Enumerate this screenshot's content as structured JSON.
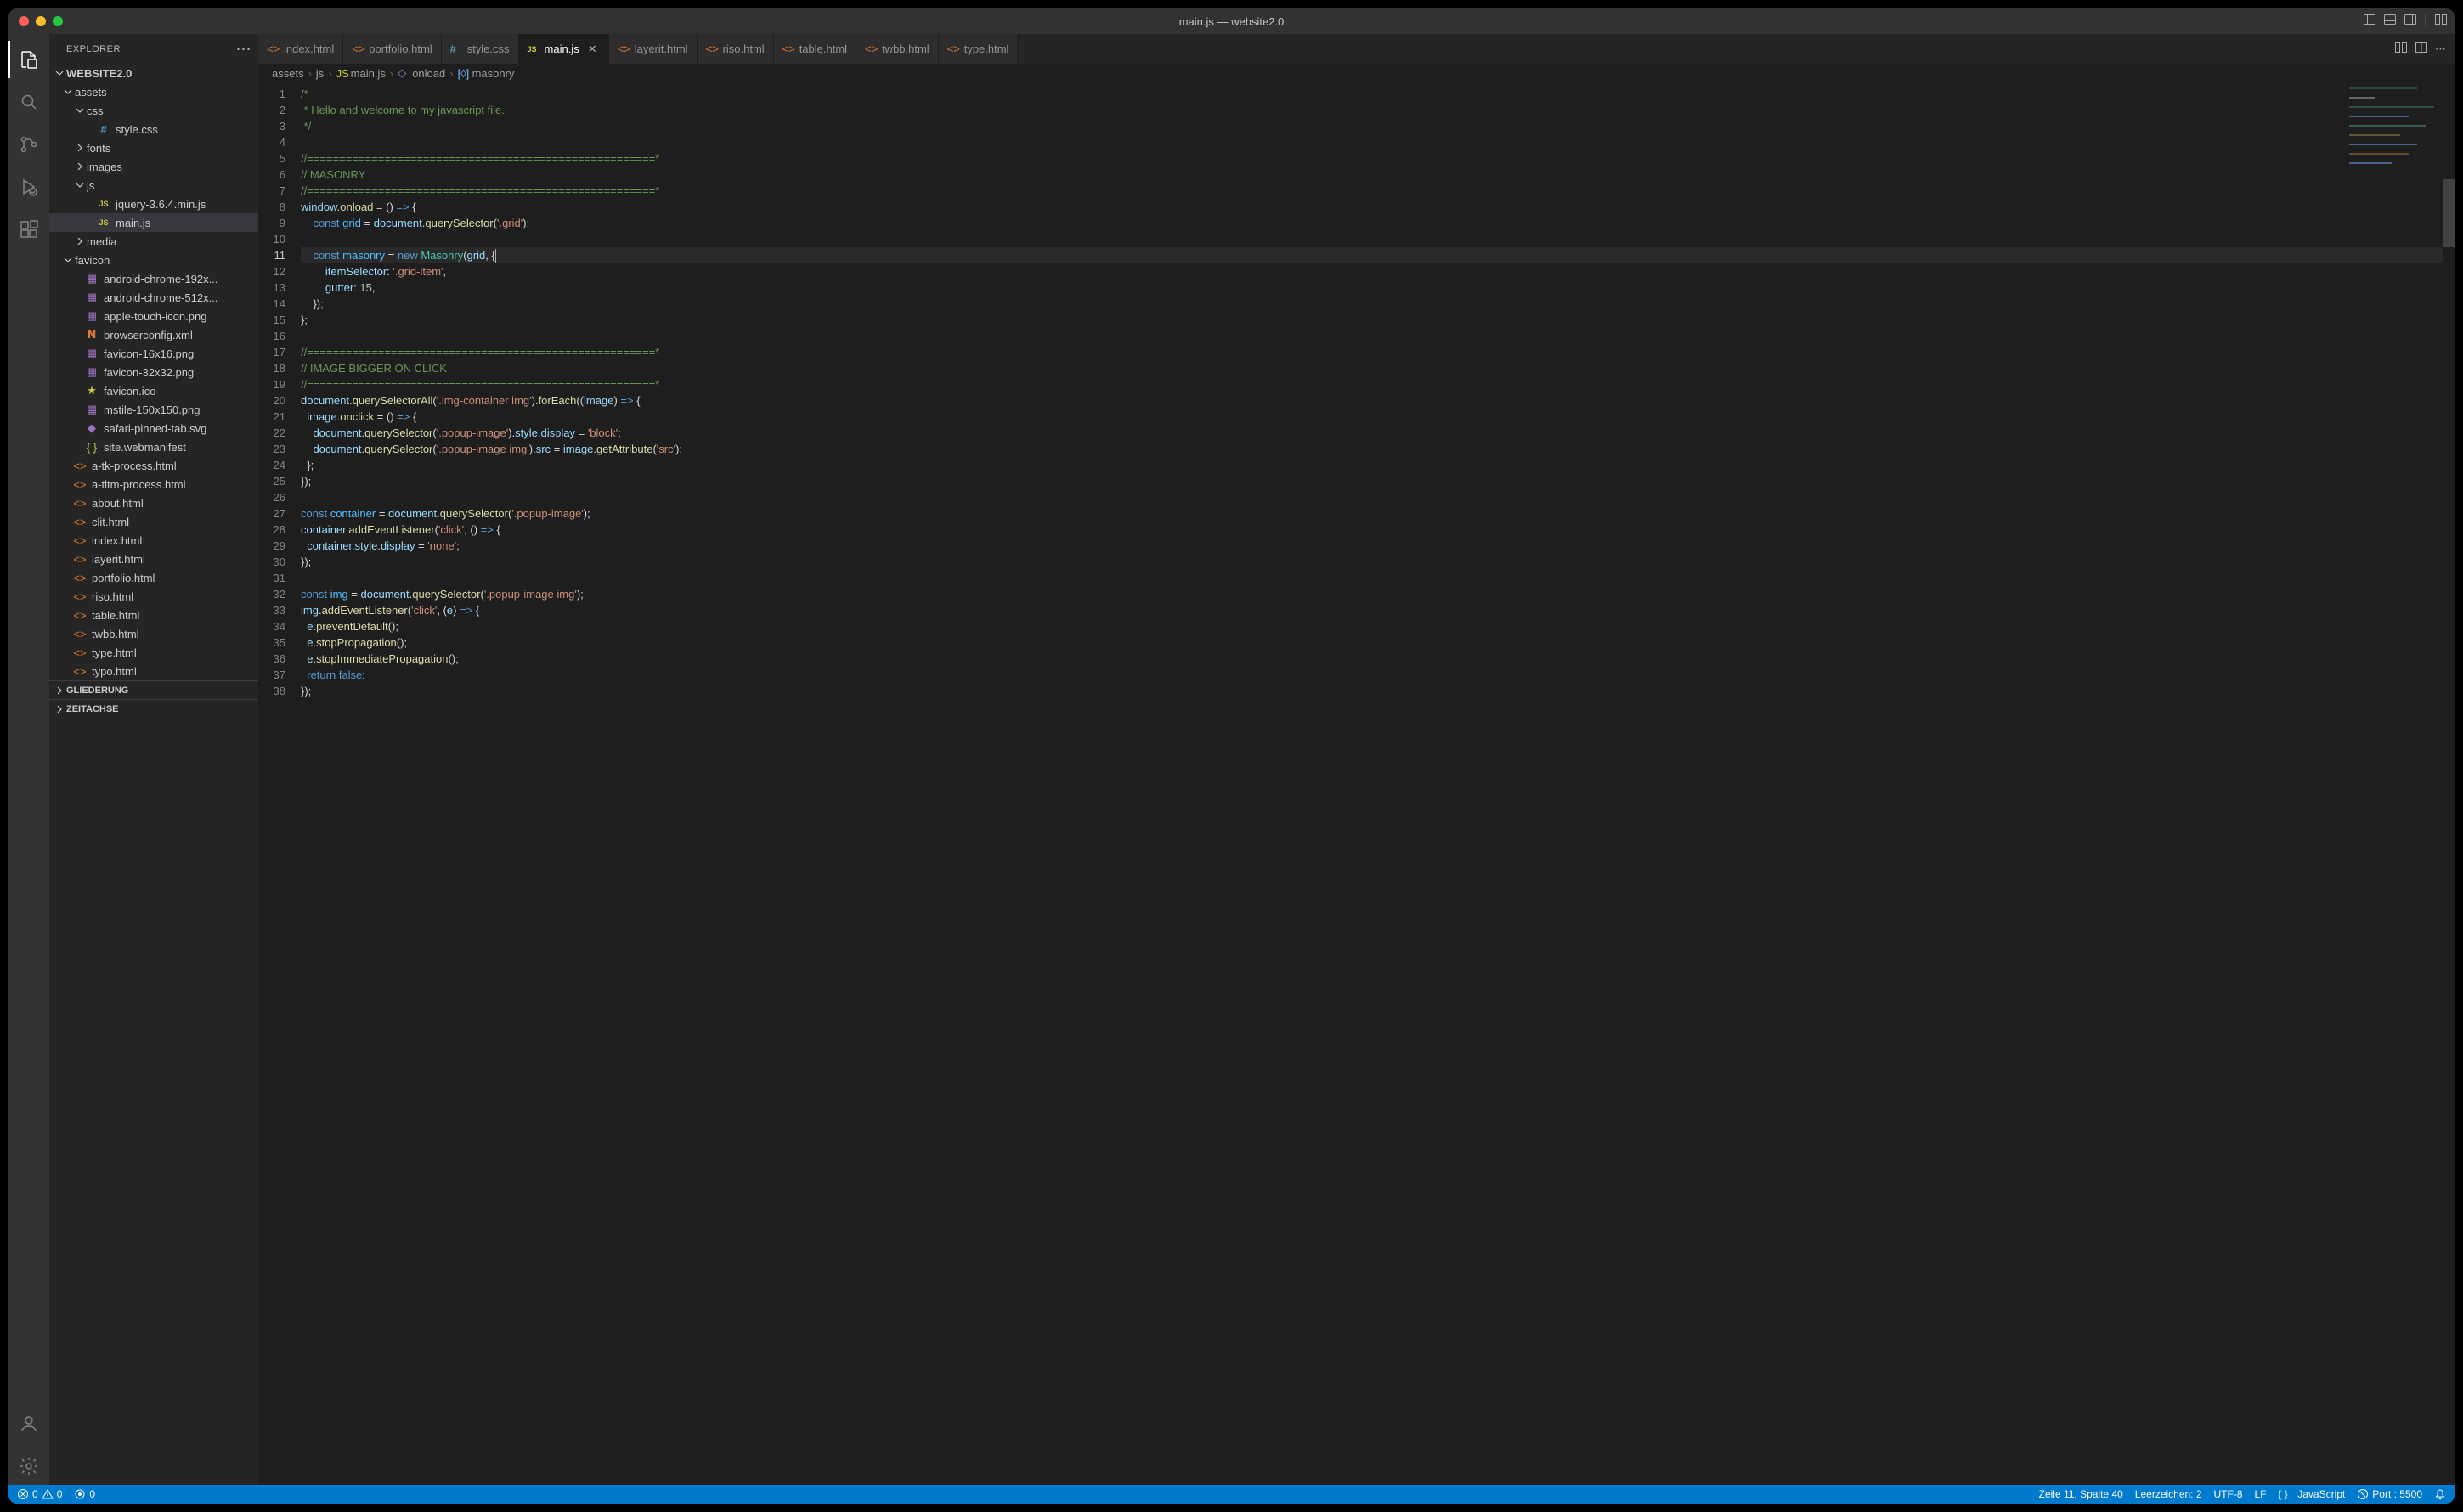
{
  "window_title": "main.js — website2.0",
  "sidebar_title": "EXPLORER",
  "project_name": "WEBSITE2.0",
  "tree": [
    {
      "type": "folder",
      "label": "assets",
      "indent": 1,
      "open": true
    },
    {
      "type": "folder",
      "label": "css",
      "indent": 2,
      "open": true
    },
    {
      "type": "file",
      "label": "style.css",
      "indent": 3,
      "icon": "css"
    },
    {
      "type": "folder",
      "label": "fonts",
      "indent": 2,
      "open": false
    },
    {
      "type": "folder",
      "label": "images",
      "indent": 2,
      "open": false
    },
    {
      "type": "folder",
      "label": "js",
      "indent": 2,
      "open": true
    },
    {
      "type": "file",
      "label": "jquery-3.6.4.min.js",
      "indent": 3,
      "icon": "js"
    },
    {
      "type": "file",
      "label": "main.js",
      "indent": 3,
      "icon": "js",
      "active": true
    },
    {
      "type": "folder",
      "label": "media",
      "indent": 2,
      "open": false
    },
    {
      "type": "folder",
      "label": "favicon",
      "indent": 1,
      "open": true
    },
    {
      "type": "file",
      "label": "android-chrome-192x...",
      "indent": 2,
      "icon": "img"
    },
    {
      "type": "file",
      "label": "android-chrome-512x...",
      "indent": 2,
      "icon": "img"
    },
    {
      "type": "file",
      "label": "apple-touch-icon.png",
      "indent": 2,
      "icon": "img"
    },
    {
      "type": "file",
      "label": "browserconfig.xml",
      "indent": 2,
      "icon": "xml"
    },
    {
      "type": "file",
      "label": "favicon-16x16.png",
      "indent": 2,
      "icon": "img"
    },
    {
      "type": "file",
      "label": "favicon-32x32.png",
      "indent": 2,
      "icon": "img"
    },
    {
      "type": "file",
      "label": "favicon.ico",
      "indent": 2,
      "icon": "star"
    },
    {
      "type": "file",
      "label": "mstile-150x150.png",
      "indent": 2,
      "icon": "img"
    },
    {
      "type": "file",
      "label": "safari-pinned-tab.svg",
      "indent": 2,
      "icon": "svg"
    },
    {
      "type": "file",
      "label": "site.webmanifest",
      "indent": 2,
      "icon": "json"
    },
    {
      "type": "file",
      "label": "a-tk-process.html",
      "indent": 1,
      "icon": "html"
    },
    {
      "type": "file",
      "label": "a-tltm-process.html",
      "indent": 1,
      "icon": "html"
    },
    {
      "type": "file",
      "label": "about.html",
      "indent": 1,
      "icon": "html"
    },
    {
      "type": "file",
      "label": "clit.html",
      "indent": 1,
      "icon": "html"
    },
    {
      "type": "file",
      "label": "index.html",
      "indent": 1,
      "icon": "html"
    },
    {
      "type": "file",
      "label": "layerit.html",
      "indent": 1,
      "icon": "html"
    },
    {
      "type": "file",
      "label": "portfolio.html",
      "indent": 1,
      "icon": "html"
    },
    {
      "type": "file",
      "label": "riso.html",
      "indent": 1,
      "icon": "html"
    },
    {
      "type": "file",
      "label": "table.html",
      "indent": 1,
      "icon": "html"
    },
    {
      "type": "file",
      "label": "twbb.html",
      "indent": 1,
      "icon": "html"
    },
    {
      "type": "file",
      "label": "type.html",
      "indent": 1,
      "icon": "html"
    },
    {
      "type": "file",
      "label": "typo.html",
      "indent": 1,
      "icon": "html"
    }
  ],
  "sidebar_bottom": [
    "GLIEDERUNG",
    "ZEITACHSE"
  ],
  "tabs": [
    {
      "label": "index.html",
      "icon": "html"
    },
    {
      "label": "portfolio.html",
      "icon": "html"
    },
    {
      "label": "style.css",
      "icon": "css"
    },
    {
      "label": "main.js",
      "icon": "js",
      "active": true
    },
    {
      "label": "layerit.html",
      "icon": "html"
    },
    {
      "label": "riso.html",
      "icon": "html"
    },
    {
      "label": "table.html",
      "icon": "html"
    },
    {
      "label": "twbb.html",
      "icon": "html"
    },
    {
      "label": "type.html",
      "icon": "html"
    }
  ],
  "breadcrumb": {
    "p1": "assets",
    "p2": "js",
    "p3": "main.js",
    "p4": "onload",
    "p5": "masonry"
  },
  "code_lines": 38,
  "statusbar": {
    "errors": "0",
    "warnings": "0",
    "port_no": "0",
    "cursor": "Zeile 11, Spalte 40",
    "spaces": "Leerzeichen: 2",
    "encoding": "UTF-8",
    "eol": "LF",
    "language": "JavaScript",
    "port": "Port : 5500"
  }
}
